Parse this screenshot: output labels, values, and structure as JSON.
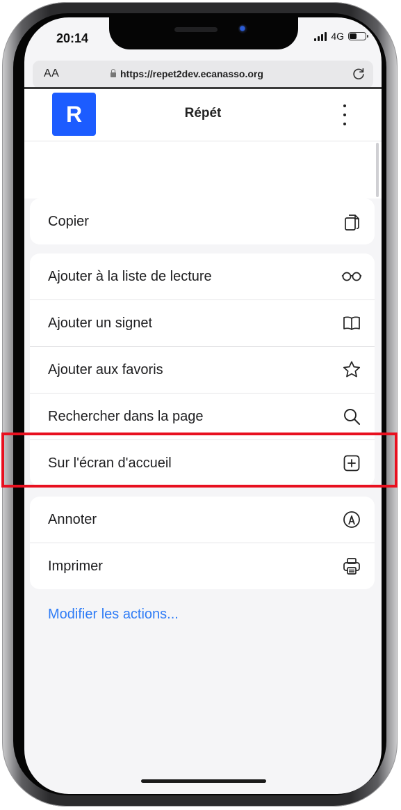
{
  "status_bar": {
    "time": "20:14",
    "network": "4G",
    "battery_level": 0.5
  },
  "browser": {
    "text_size_label": "AA",
    "url": "https://repet2dev.ecanasso.org"
  },
  "app_header": {
    "logo_letter": "R",
    "title": "Répét"
  },
  "share_menu": {
    "group1": [
      {
        "label": "Copier",
        "icon": "copy-icon"
      }
    ],
    "group2": [
      {
        "label": "Ajouter à la liste de lecture",
        "icon": "glasses-icon"
      },
      {
        "label": "Ajouter un signet",
        "icon": "book-icon"
      },
      {
        "label": "Ajouter aux favoris",
        "icon": "star-icon"
      },
      {
        "label": "Rechercher dans la page",
        "icon": "search-icon"
      },
      {
        "label": "Sur l'écran d'accueil",
        "icon": "add-square-icon",
        "highlighted": true
      }
    ],
    "group3": [
      {
        "label": "Annoter",
        "icon": "markup-icon"
      },
      {
        "label": "Imprimer",
        "icon": "printer-icon"
      }
    ],
    "edit_actions_label": "Modifier les actions..."
  },
  "colors": {
    "accent_link": "#2f7cf6",
    "logo": "#1c5cff",
    "highlight": "#e8101f"
  }
}
